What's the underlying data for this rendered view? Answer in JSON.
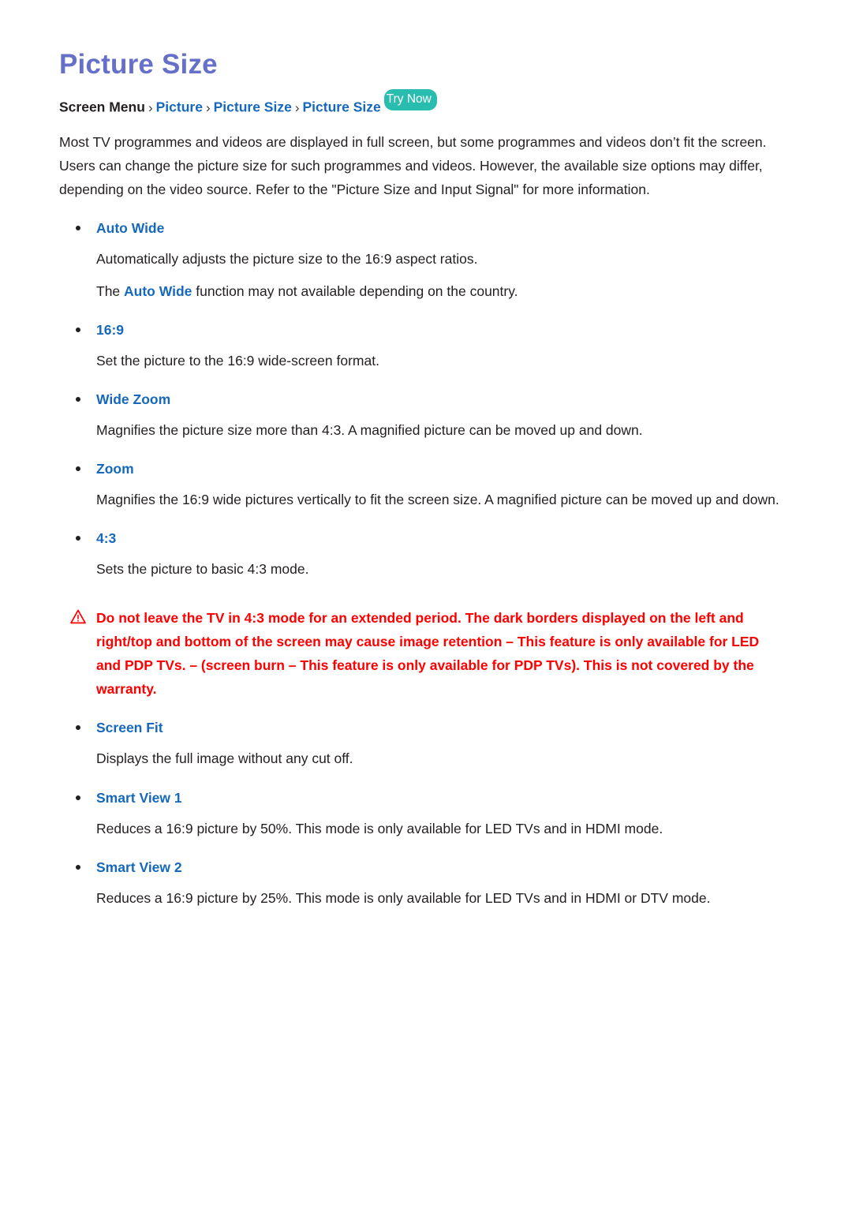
{
  "page": {
    "title": "Picture Size",
    "title_color": "#6670C8",
    "link_color": "#1668BC",
    "text_color": "#231F20",
    "warning_color": "#FF0000",
    "badge_color": "#29BDAF",
    "background": "#FFFFFF"
  },
  "breadcrumb": {
    "root": "Screen Menu",
    "separator": "›",
    "links": [
      "Picture",
      "Picture Size",
      "Picture Size"
    ],
    "badge": "Try Now"
  },
  "intro": "Most TV programmes and videos are displayed in full screen, but some programmes and videos don’t fit the screen. Users can change the picture size for such programmes and videos. However, the available size options may differ, depending on the video source. Refer to the \"Picture Size and Input Signal\" for more information.",
  "options": [
    {
      "label": "Auto Wide",
      "paragraphs": [
        {
          "text": "Automatically adjusts the picture size to the 16:9 aspect ratios."
        },
        {
          "pre": "The ",
          "highlight": "Auto Wide",
          "post": " function may not available depending on the country."
        }
      ]
    },
    {
      "label": "16:9",
      "paragraphs": [
        {
          "text": "Set the picture to the 16:9 wide-screen format."
        }
      ]
    },
    {
      "label": "Wide Zoom",
      "paragraphs": [
        {
          "text": "Magnifies the picture size more than 4:3. A magnified picture can be moved up and down."
        }
      ]
    },
    {
      "label": "Zoom",
      "paragraphs": [
        {
          "text": "Magnifies the 16:9 wide pictures vertically to fit the screen size. A magnified picture can be moved up and down."
        }
      ]
    },
    {
      "label": "4:3",
      "paragraphs": [
        {
          "text": "Sets the picture to basic 4:3 mode."
        }
      ]
    }
  ],
  "warning": {
    "icon": "warning-triangle-icon",
    "text": "Do not leave the TV in 4:3 mode for an extended period. The dark borders displayed on the left and right/top and bottom of the screen may cause image retention – This feature is only available for LED and PDP TVs. – (screen burn – This feature is only available for PDP TVs). This is not covered by the warranty."
  },
  "options_after_warning": [
    {
      "label": "Screen Fit",
      "paragraphs": [
        {
          "text": "Displays the full image without any cut off."
        }
      ]
    },
    {
      "label": "Smart View 1",
      "paragraphs": [
        {
          "text": "Reduces a 16:9 picture by 50%. This mode is only available for LED TVs and in HDMI mode."
        }
      ]
    },
    {
      "label": "Smart View 2",
      "paragraphs": [
        {
          "text": "Reduces a 16:9 picture by 25%. This mode is only available for LED TVs and in HDMI or DTV mode."
        }
      ]
    }
  ]
}
